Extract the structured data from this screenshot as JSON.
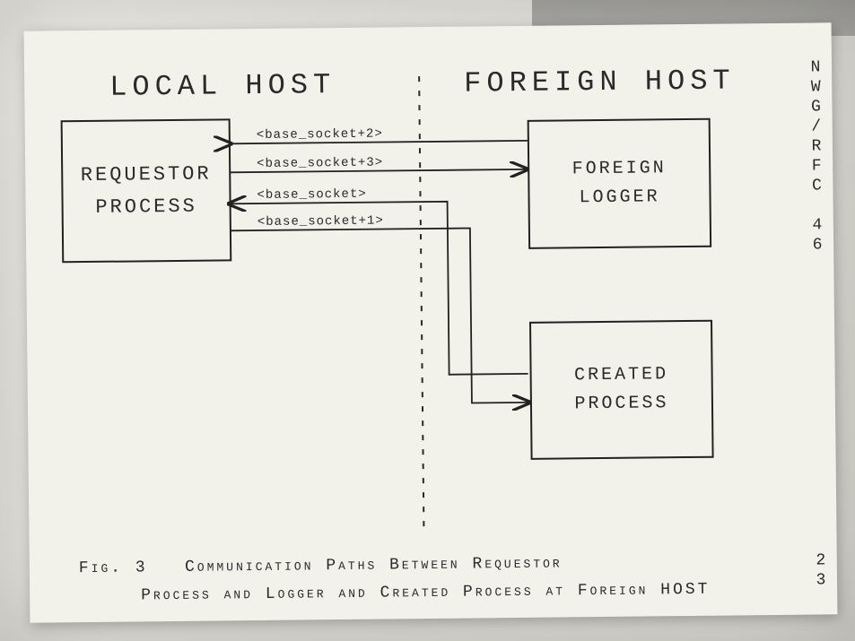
{
  "document": {
    "header_right": "NWG/RFC 46",
    "page_number": "23",
    "figure_number": "Fig. 3",
    "caption_line1": "Communication Paths Between Requestor",
    "caption_line2": "Process and Logger and Created Process at Foreign HOST"
  },
  "left_column_title": "LOCAL HOST",
  "right_column_title": "FOREIGN HOST",
  "boxes": {
    "requestor": "REQUESTOR\nPROCESS",
    "foreign_logger": "FOREIGN\nLOGGER",
    "created_process": "CREATED\nPROCESS"
  },
  "connections": [
    {
      "id": "c1",
      "label": "<base_socket+2>",
      "from": "foreign_logger",
      "to": "requestor",
      "direction": "right-to-left"
    },
    {
      "id": "c2",
      "label": "<base_socket+3>",
      "from": "requestor",
      "to": "foreign_logger",
      "direction": "left-to-right"
    },
    {
      "id": "c3",
      "label": "<base_socket>",
      "from": "created_process",
      "to": "requestor",
      "direction": "right-to-left"
    },
    {
      "id": "c4",
      "label": "<base_socket+1>",
      "from": "requestor",
      "to": "created_process",
      "direction": "left-to-right"
    }
  ]
}
